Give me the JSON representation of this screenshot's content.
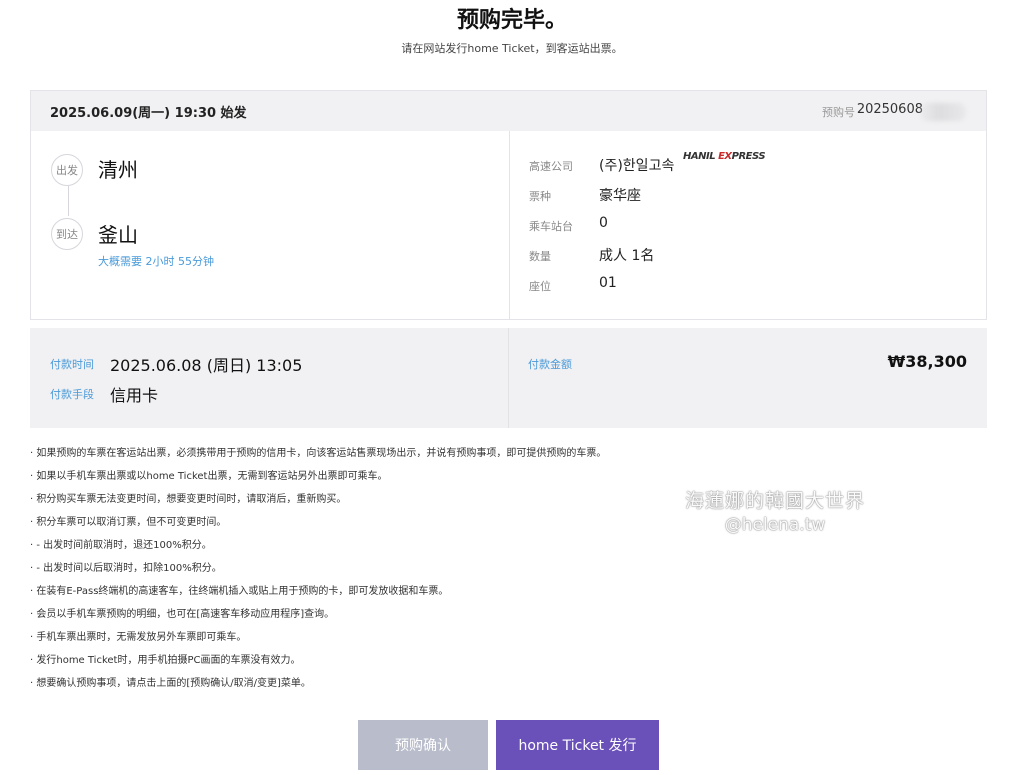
{
  "header": {
    "title": "预购完毕。",
    "subtitle": "请在网站发行home Ticket，到客运站出票。"
  },
  "ticket": {
    "departure_datetime": "2025.06.09(周一) 19:30 始发",
    "reservation_label": "预购号",
    "reservation_number": "20250608",
    "route": {
      "departure_tag": "出发",
      "departure_city": "清州",
      "arrival_tag": "到达",
      "arrival_city": "釜山",
      "duration": "大概需要 2小时 55分钟"
    },
    "details": [
      {
        "label": "高速公司",
        "value": "(주)한일고속"
      },
      {
        "label": "票种",
        "value": "豪华座"
      },
      {
        "label": "乘车站台",
        "value": "0"
      },
      {
        "label": "数量",
        "value": "成人 1名"
      },
      {
        "label": "座位",
        "value": "01"
      }
    ],
    "company_logo_text": "HANIL EXPRESS"
  },
  "payment": {
    "time_label": "付款时间",
    "time_value": "2025.06.08 (周日) 13:05",
    "method_label": "付款手段",
    "method_value": "信用卡",
    "amount_label": "付款金额",
    "amount_value": "₩38,300"
  },
  "notes": [
    "· 如果预购的车票在客运站出票，必须携带用于预购的信用卡，向该客运站售票现场出示，并说有预购事项，即可提供预购的车票。",
    "· 如果以手机车票出票或以home Ticket出票，无需到客运站另外出票即可乘车。",
    "· 积分购买车票无法变更时间，想要变更时间时，请取消后，重新购买。",
    "· 积分车票可以取消订票，但不可变更时间。",
    "· - 出发时间前取消时，退还100%积分。",
    "· - 出发时间以后取消时，扣除100%积分。",
    "· 在装有E-Pass终端机的高速客车，往终端机插入或贴上用于预购的卡，即可发放收据和车票。",
    "· 会员以手机车票预购的明细，也可在[高速客车移动应用程序]查询。",
    "· 手机车票出票时，无需发放另外车票即可乘车。",
    "· 发行home Ticket时，用手机拍摄PC画面的车票没有效力。",
    "· 想要确认预购事项，请点击上面的[预购确认/取消/变更]菜单。"
  ],
  "watermark": {
    "line1": "海蓮娜的韓國大世界",
    "line2": "@helena.tw"
  },
  "buttons": {
    "confirm": "预购确认",
    "issue": "home Ticket 发行"
  },
  "colors": {
    "accent_blue": "#4a9ad8",
    "primary_button": "#6a50b9",
    "secondary_button": "#b9bccb",
    "panel_bg": "#f1f1f3"
  }
}
